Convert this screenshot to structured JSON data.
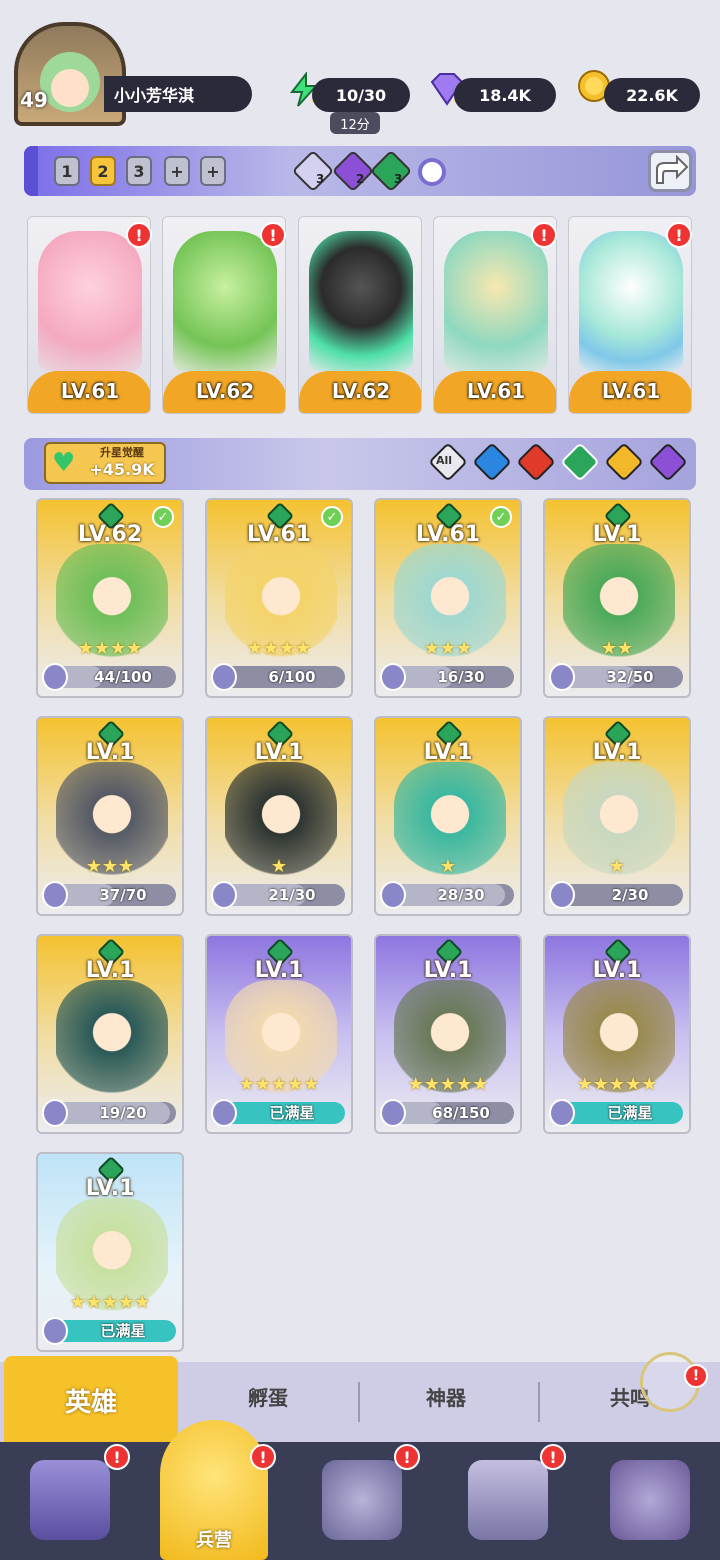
{
  "player": {
    "level": "49",
    "name": "小小芳华淇"
  },
  "resources": {
    "energy": "10/30",
    "energy_timer": "12分",
    "gems": "18.4K",
    "coins": "22.6K"
  },
  "team_bar": {
    "tabs": [
      "1",
      "2",
      "3"
    ],
    "active_tab": "2",
    "extra_tabs": [
      "+",
      "+"
    ],
    "gem_counts": [
      "3",
      "2",
      "3"
    ],
    "share_icon": "share-icon",
    "search_icon": "search-icon"
  },
  "team": [
    {
      "level": "LV.61",
      "stars": "★★★",
      "element": "nature",
      "alert": "!"
    },
    {
      "level": "LV.62",
      "stars": "★★★",
      "element": "nature",
      "alert": "!"
    },
    {
      "level": "LV.62",
      "stars": "★★",
      "element": "dark",
      "alert": ""
    },
    {
      "level": "LV.61",
      "stars": "★",
      "element": "nature",
      "alert": "!"
    },
    {
      "level": "LV.61",
      "stars": "★",
      "element": "dark",
      "alert": "!"
    }
  ],
  "awaken": {
    "label": "升星觉醒",
    "value": "+45.9K"
  },
  "filters": [
    "All",
    "water",
    "fire",
    "nature",
    "light",
    "dark"
  ],
  "heroes": [
    {
      "level": "LV.62",
      "stars": "★★★★",
      "progress": "44/100",
      "fraction": 0.44,
      "checked": true,
      "bg": "gold"
    },
    {
      "level": "LV.61",
      "stars": "★★★★",
      "progress": "6/100",
      "fraction": 0.06,
      "checked": true,
      "bg": "gold"
    },
    {
      "level": "LV.61",
      "stars": "★★★",
      "progress": "16/30",
      "fraction": 0.53,
      "checked": true,
      "bg": "gold"
    },
    {
      "level": "LV.1",
      "stars": "★★",
      "progress": "32/50",
      "fraction": 0.64,
      "checked": false,
      "bg": "gold"
    },
    {
      "level": "LV.1",
      "stars": "★★★",
      "progress": "37/70",
      "fraction": 0.53,
      "checked": false,
      "bg": "gold"
    },
    {
      "level": "LV.1",
      "stars": "★",
      "progress": "21/30",
      "fraction": 0.7,
      "checked": false,
      "bg": "gold"
    },
    {
      "level": "LV.1",
      "stars": "★",
      "progress": "28/30",
      "fraction": 0.93,
      "checked": false,
      "bg": "gold"
    },
    {
      "level": "LV.1",
      "stars": "★",
      "progress": "2/30",
      "fraction": 0.07,
      "checked": false,
      "bg": "gold"
    },
    {
      "level": "LV.1",
      "stars": "",
      "progress": "19/20",
      "fraction": 0.95,
      "checked": false,
      "bg": "gold"
    },
    {
      "level": "LV.1",
      "stars": "★★★★★",
      "progress": "已满星",
      "fraction": 1,
      "checked": false,
      "bg": "purple"
    },
    {
      "level": "LV.1",
      "stars": "★★★★★",
      "progress": "68/150",
      "fraction": 0.45,
      "checked": false,
      "bg": "purple"
    },
    {
      "level": "LV.1",
      "stars": "★★★★★",
      "progress": "已满星",
      "fraction": 1,
      "checked": false,
      "bg": "purple"
    },
    {
      "level": "LV.1",
      "stars": "★★★★★",
      "progress": "已满星",
      "fraction": 1,
      "checked": false,
      "bg": "blue"
    }
  ],
  "subtabs": [
    "英雄",
    "孵蛋",
    "神器",
    "共鸣"
  ],
  "nav": {
    "active_label": "兵营",
    "alert": "!"
  }
}
